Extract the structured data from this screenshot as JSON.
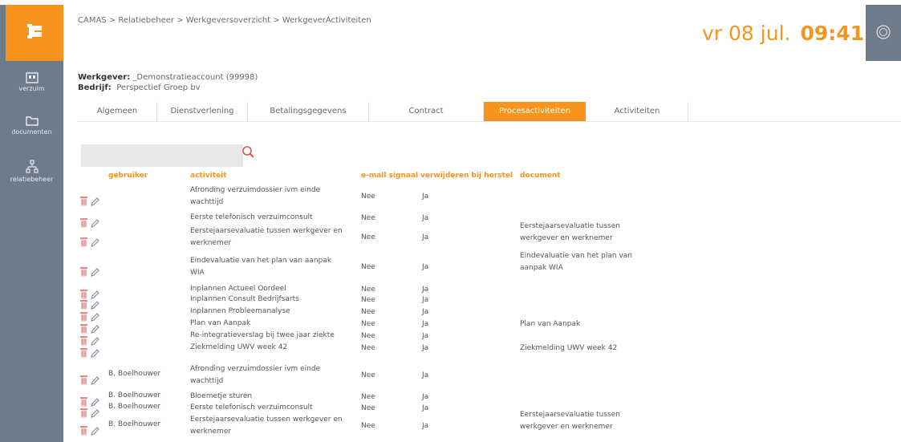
{
  "sidebar": {
    "items": [
      {
        "label": "verzuim",
        "icon": "id-card-icon"
      },
      {
        "label": "documenten",
        "icon": "folder-icon"
      },
      {
        "label": "relatiebeheer",
        "icon": "hierarchy-icon"
      }
    ]
  },
  "header": {
    "breadcrumb": "CAMAS > Relatiebeheer > Werkgeversoverzicht > WerkgeverActiviteiten",
    "date": "vr 08 jul.",
    "time": "09:41"
  },
  "employer": {
    "werkgever_label": "Werkgever:",
    "werkgever_value": "_Demonstratieaccount (99998)",
    "bedrijf_label": "Bedrijf:",
    "bedrijf_value": "Perspectief Groep bv"
  },
  "tabs": [
    {
      "label": "Algemeen"
    },
    {
      "label": "Dienstverlening"
    },
    {
      "label": "Betalingsgegevens"
    },
    {
      "label": "Contract"
    },
    {
      "label": "Procesactiviteiten"
    },
    {
      "label": "Activiteiten"
    }
  ],
  "active_tab": "Procesactiviteiten",
  "colors": {
    "accent": "#f7941d",
    "sidebar": "#6e7b8b"
  },
  "table": {
    "headers": {
      "gebruiker": "gebruiker",
      "activiteit": "activiteit",
      "email": "e-mail signaal",
      "verwijderen": "verwijderen bij herstel",
      "document": "document"
    },
    "rows": [
      {
        "gebruiker": "",
        "activiteit": [
          "Afronding verzuimdossier ivm einde",
          "wachttijd"
        ],
        "email": "Nee",
        "verwijderen": "Ja",
        "document": []
      },
      {
        "gebruiker": "",
        "activiteit": [
          "Eerste telefonisch verzuimconsult"
        ],
        "email": "Nee",
        "verwijderen": "Ja",
        "document": []
      },
      {
        "gebruiker": "",
        "activiteit": [
          "Eerstejaarsevaluatie tussen werkgever en",
          "werknemer"
        ],
        "email": "Nee",
        "verwijderen": "Ja",
        "document": [
          "Eerstejaarsevaluatie tussen",
          "werkgever en werknemer"
        ]
      },
      {
        "gebruiker": "",
        "activiteit": [
          "Eindevaluatie van het plan van aanpak",
          "WIA"
        ],
        "email": "Nee",
        "verwijderen": "Ja",
        "document": [
          "Eindevaluatie van het plan van",
          "aanpak WIA"
        ]
      },
      {
        "gebruiker": "",
        "activiteit": [
          "Inplannen Actueel Oordeel"
        ],
        "email": "Nee",
        "verwijderen": "Ja",
        "document": []
      },
      {
        "gebruiker": "",
        "activiteit": [
          "Inplannen Consult Bedrijfsarts"
        ],
        "email": "Nee",
        "verwijderen": "Ja",
        "document": []
      },
      {
        "gebruiker": "",
        "activiteit": [
          "Inplannen Probleemanalyse"
        ],
        "email": "Nee",
        "verwijderen": "Ja",
        "document": []
      },
      {
        "gebruiker": "",
        "activiteit": [
          "Plan van Aanpak"
        ],
        "email": "Nee",
        "verwijderen": "Ja",
        "document": [
          "Plan van Aanpak"
        ]
      },
      {
        "gebruiker": "",
        "activiteit": [
          "Re-integratieverslag bij twee jaar ziekte"
        ],
        "email": "Nee",
        "verwijderen": "Ja",
        "document": []
      },
      {
        "gebruiker": "",
        "activiteit": [
          "Ziekmelding UWV week 42"
        ],
        "email": "Nee",
        "verwijderen": "Ja",
        "document": [
          "Ziekmelding UWV week 42"
        ]
      },
      {
        "gebruiker": "B. Boelhouwer",
        "activiteit": [
          "Afronding verzuimdossier ivm einde",
          "wachttijd"
        ],
        "email": "Nee",
        "verwijderen": "Ja",
        "document": []
      },
      {
        "gebruiker": "B. Boelhouwer",
        "activiteit": [
          "Bloemetje sturen"
        ],
        "email": "Nee",
        "verwijderen": "Ja",
        "document": []
      },
      {
        "gebruiker": "B. Boelhouwer",
        "activiteit": [
          "Eerste telefonisch verzuimconsult"
        ],
        "email": "Nee",
        "verwijderen": "Ja",
        "document": []
      },
      {
        "gebruiker": "B. Boelhouwer",
        "activiteit": [
          "Eerstejaarsevaluatie tussen werkgever en",
          "werknemer"
        ],
        "email": "Nee",
        "verwijderen": "Ja",
        "document": [
          "Eerstejaarsevaluatie tussen",
          "werkgever en werknemer"
        ]
      }
    ]
  }
}
